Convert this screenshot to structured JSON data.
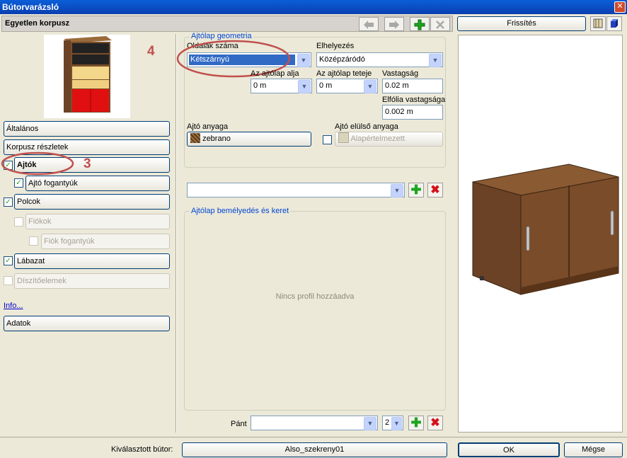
{
  "window": {
    "title": "Bútorvarázsló",
    "close": "✕"
  },
  "header": {
    "title": "Egyetlen korpusz",
    "back_icon": "arrow-left-icon",
    "forward_icon": "arrow-right-icon",
    "add_icon": "plus-icon",
    "delete_icon": "x-icon"
  },
  "annotations": {
    "four": "4",
    "three": "3"
  },
  "nav": {
    "altalanos": "Általános",
    "korpusz_reszletek": "Korpusz részletek",
    "ajtok": "Ajtók",
    "ajto_fogantyuk": "Ajtó fogantyúk",
    "polcok": "Polcok",
    "fiokok": "Fiókok",
    "fiok_fogantyuk": "Fiók fogantyúk",
    "labazat": "Lábazat",
    "diszitoelemek": "Díszítőelemek",
    "info": "Info...",
    "adatok": "Adatok"
  },
  "check": "✓",
  "geometry": {
    "group_label": "Ajtólap geometria",
    "oldalak_label": "Oldalak száma",
    "oldalak_value": "Kétszárnyú",
    "elhelyezes_label": "Elhelyezés",
    "elhelyezes_value": "Középzáródó",
    "alja_label": "Az ajtólap alja",
    "alja_value": "0 m",
    "teteje_label": "Az ajtólap teteje",
    "teteje_value": "0 m",
    "vastagsag_label": "Vastagság",
    "vastagsag_value": "0.02 m",
    "elfolia_label": "Elfólia vastagsága",
    "elfolia_value": "0.002 m",
    "anyag_label": "Ajtó anyaga",
    "anyag_value": "zebrano",
    "eloelso_label": "Ajtó elülső anyaga",
    "eloelso_value": "Alapértelmezett"
  },
  "profile": {
    "group_label": "Ajtólap bemélyedés és keret",
    "empty_text": "Nincs profil hozzáadva",
    "add": "✚",
    "del": "✖"
  },
  "hinge": {
    "label": "Pánt",
    "count": "2"
  },
  "preview": {
    "refresh": "Frissítés"
  },
  "footer": {
    "selected_label": "Kiválasztott bútor:",
    "selected_value": "Also_szekreny01",
    "ok": "OK",
    "cancel": "Mégse"
  },
  "colors": {
    "annotation": "#c0504d",
    "accent": "#0046d5",
    "wood": "#6b4226"
  }
}
